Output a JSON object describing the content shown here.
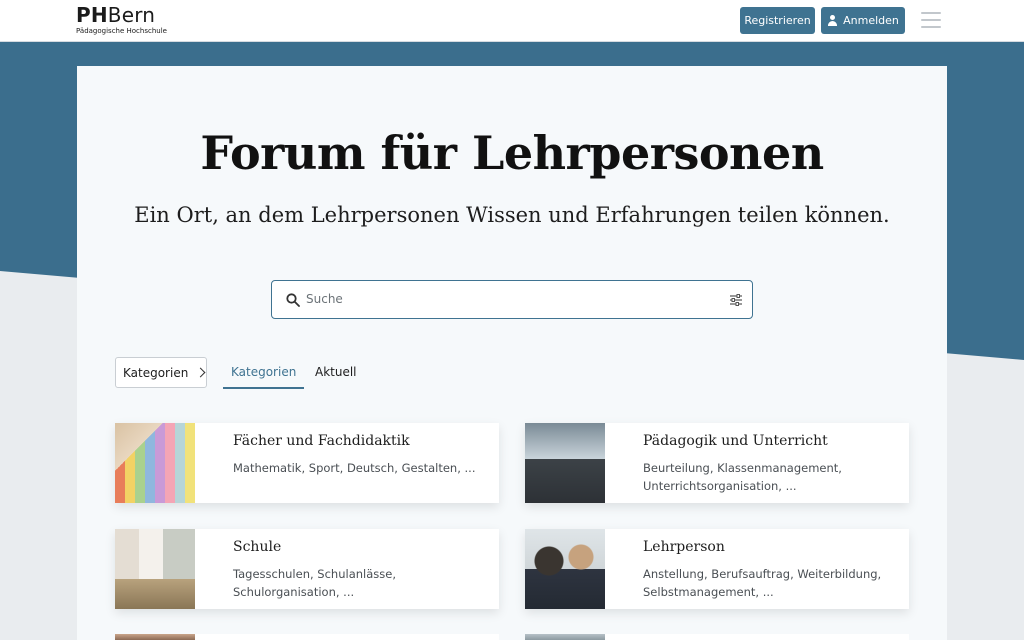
{
  "header": {
    "logo_ph": "PH",
    "logo_bern": "Bern",
    "logo_sub": "Pädagogische Hochschule",
    "register_label": "Registrieren",
    "login_label": "Anmelden"
  },
  "hero": {
    "title": "Forum für Lehrpersonen",
    "subtitle": "Ein Ort, an dem Lehrpersonen Wissen und Erfahrungen teilen können."
  },
  "search": {
    "placeholder": "Suche",
    "value": ""
  },
  "nav": {
    "dropdown_label": "Kategorien",
    "tabs": [
      {
        "label": "Kategorien",
        "active": true
      },
      {
        "label": "Aktuell",
        "active": false
      }
    ]
  },
  "categories": [
    {
      "title": "Fächer und Fachdidaktik",
      "desc": "Mathematik, Sport, Deutsch, Gestalten, ...",
      "image": "colored-pencils-photo"
    },
    {
      "title": "Pädagogik und Unterricht",
      "desc": "Beurteilung, Klassenmanagement, Unterrichtsorganisation, ...",
      "image": "classroom-laptop-photo"
    },
    {
      "title": "Schule",
      "desc": "Tagesschulen, Schulanlässe, Schulorganisation, ...",
      "image": "school-hallway-photo"
    },
    {
      "title": "Lehrperson",
      "desc": "Anstellung, Berufsauftrag, Weiterbildung, Selbstmanagement, ...",
      "image": "teacher-students-photo"
    }
  ],
  "colors": {
    "accent": "#3f7391",
    "band": "#3b6e8d",
    "card": "#f6f9fb",
    "page_bg": "#e9ecef"
  }
}
